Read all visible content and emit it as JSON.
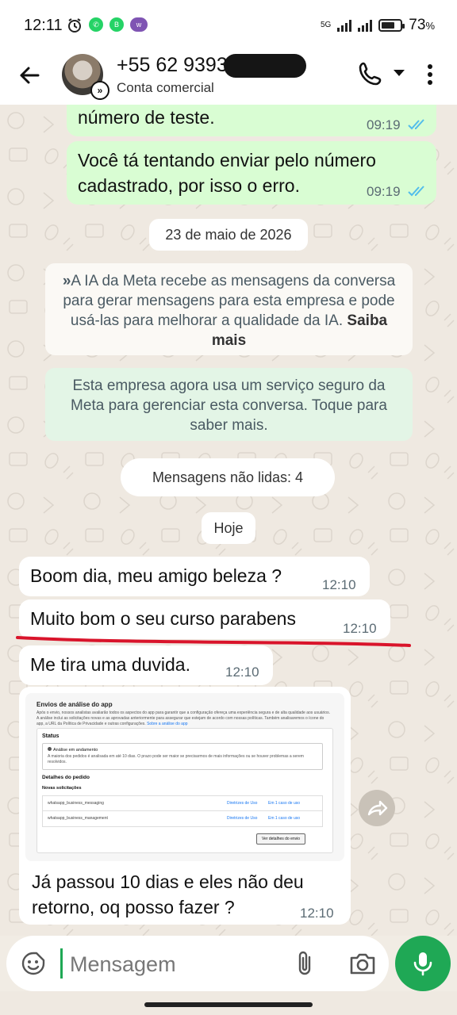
{
  "status_bar": {
    "time": "12:11",
    "app_icons": [
      "clock-icon",
      "whatsapp-icon",
      "whatsapp-business-icon",
      "woo-icon"
    ],
    "network": "5G",
    "battery": "73",
    "battery_unit": "%",
    "battery_level": 0.73
  },
  "header": {
    "contact_name": "+55 62 9393",
    "contact_subtitle": "Conta comercial"
  },
  "messages": {
    "out1_text": "número de teste.",
    "out1_time": "09:19",
    "out2_text": "Você tá tentando enviar pelo número cadastrado, por isso o erro.",
    "out2_time": "09:19",
    "date_pill": "23 de maio de 2026",
    "meta_ai_notice_prefix": "A IA da Meta recebe as mensagens da conversa para gerar mensagens para esta empresa e pode usá-las para melhorar a qualidade da IA.",
    "meta_ai_notice_link": "Saiba mais",
    "secure_notice": "Esta empresa agora usa um serviço seguro da Meta para gerenciar esta conversa. Toque para saber mais.",
    "unread_pill": "Mensagens não lidas: 4",
    "today_pill": "Hoje",
    "in1_text": "Boom dia, meu amigo beleza ?",
    "in1_time": "12:10",
    "in2_text": "Muito bom o seu curso parabens",
    "in2_time": "12:10",
    "in3_text": "Me tira uma duvida.",
    "in3_time": "12:10",
    "in4_caption": "Já passou 10 dias e eles não deu retorno, oq posso fazer ?",
    "in4_time": "12:10"
  },
  "screenshot_image": {
    "title": "Envios de análise do app",
    "intro": "Após o envio, nossos analistas avaliarão todos os aspectos do app para garantir que a configuração ofereça uma experiência segura e de alta qualidade aos usuários. A análise inclui as solicitações novas e as aprovadas anteriormente para assegurar que estejam de acordo com nossas políticas. Também analisaremos o ícone do app, a URL da Política de Privacidade e outras configurações.",
    "intro_link": "Sobre a análise do app",
    "status_heading": "Status",
    "status_label": "Análise em andamento",
    "status_detail": "A maioria dos pedidos é analisada em até 10 dias. O prazo pode ser maior se precisarmos de mais informações ou se houver problemas a serem resolvidos.",
    "details_heading": "Detalhes do pedido",
    "new_requests_heading": "Novas solicitações",
    "rows": [
      {
        "permission": "whatsapp_business_messaging",
        "policy": "Diretrizes de Uso",
        "cases": "Em 1 caso de uso"
      },
      {
        "permission": "whatsapp_business_management",
        "policy": "Diretrizes de Uso",
        "cases": "Em 1 caso de uso"
      }
    ],
    "button": "Ver detalhes do envio"
  },
  "composer": {
    "placeholder": "Mensagem"
  },
  "colors": {
    "outgoing_bubble": "#d9fdd3",
    "incoming_bubble": "#ffffff",
    "accent_green": "#1fa855",
    "read_ticks": "#53bdeb",
    "annotation_red": "#d9142b"
  }
}
